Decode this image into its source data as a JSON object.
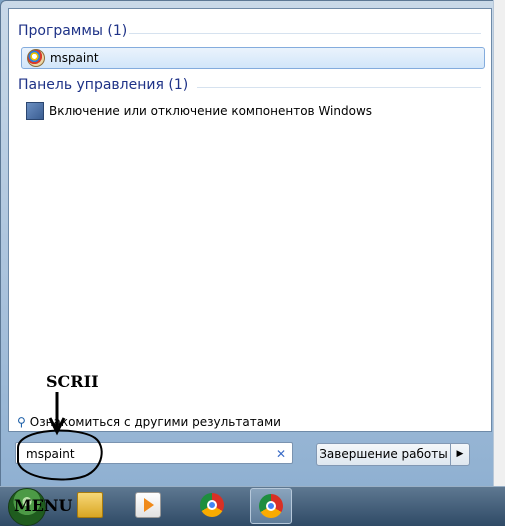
{
  "start_menu": {
    "groups": [
      {
        "header": "Программы (1)",
        "items": [
          "mspaint"
        ]
      },
      {
        "header": "Панель управления (1)",
        "items": [
          "Включение или отключение компонентов Windows"
        ]
      }
    ],
    "see_more": "Ознакомиться с другими результатами",
    "search_value": "mspaint",
    "shutdown_label": "Завершение работы"
  },
  "annotations": {
    "top_label": "SCRII",
    "bottom_label": "MENU"
  },
  "icons": {
    "clear": "close-icon",
    "shutdown_arrow": "arrow-right-icon"
  }
}
